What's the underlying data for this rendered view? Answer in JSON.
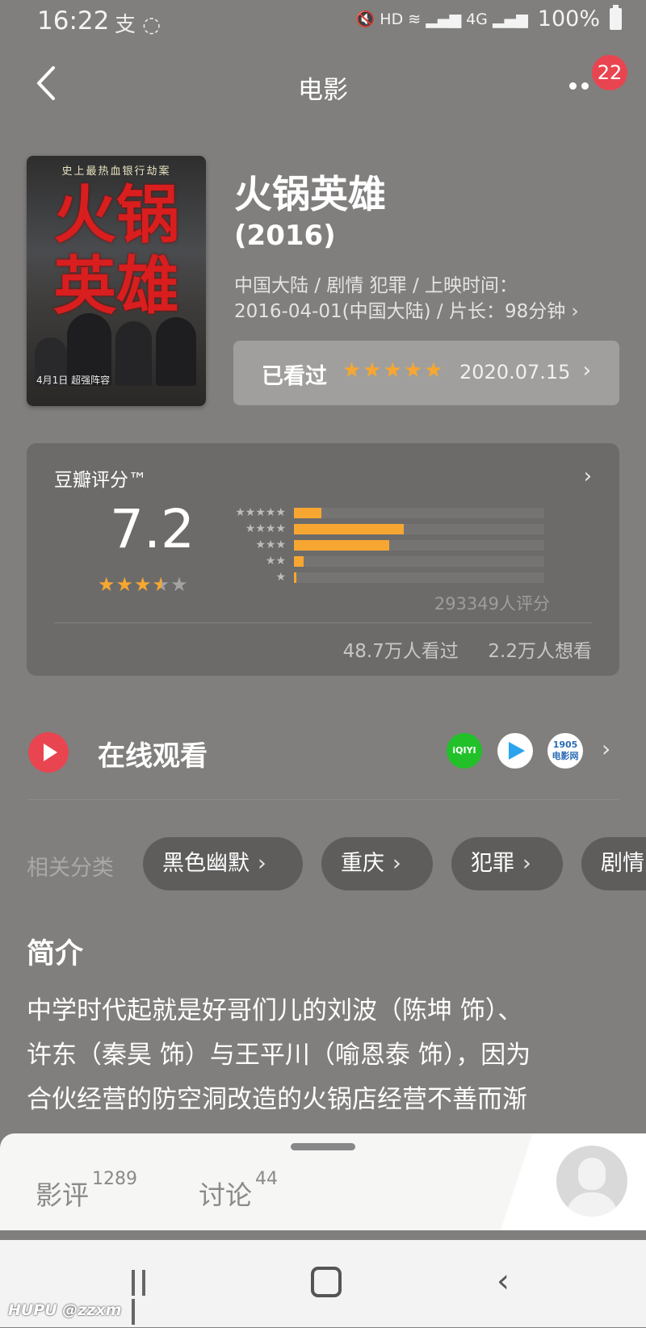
{
  "status_bar": {
    "time": "16:22",
    "app_icons": "支 ◌",
    "net_icons": "🔇 HD ≋ ▂▄▆ 4G ▂▄▆",
    "battery": "100%"
  },
  "nav": {
    "title": "电影",
    "badge": "22"
  },
  "poster": {
    "tagline": "史上最热血银行劫案",
    "title_line1": "火锅",
    "title_line2": "英雄",
    "date": "4月1日 超强阵容"
  },
  "movie": {
    "title": "火锅英雄",
    "year": "(2016)",
    "meta_line1": "中国大陆 / 剧情 犯罪 / 上映时间：",
    "meta_line2": "2016-04-01(中国大陆) / 片长：98分钟 ›"
  },
  "watched": {
    "label": "已看过",
    "stars": "★★★★★",
    "date": "2020.07.15",
    "chevron": "›"
  },
  "rating": {
    "title": "豆瓣评分™",
    "score": "7.2",
    "stars_on": "★★★",
    "star_half": "★",
    "stars_off": "★",
    "distribution": [
      {
        "stars": "★★★★★",
        "fraction": 0.11
      },
      {
        "stars": "★★★★",
        "fraction": 0.44
      },
      {
        "stars": "★★★",
        "fraction": 0.38
      },
      {
        "stars": "★★",
        "fraction": 0.04
      },
      {
        "stars": "★",
        "fraction": 0.01
      }
    ],
    "count": "293349人评分",
    "watched_count": "48.7万人看过",
    "want_count": "2.2万人想看",
    "colors": {
      "accent": "#f7a731",
      "track": "#757473"
    }
  },
  "online": {
    "label": "在线观看",
    "providers": [
      "iQIYI",
      "",
      "1905 电影网"
    ],
    "chevron": "›"
  },
  "categories": {
    "label": "相关分类",
    "items": [
      "黑色幽默",
      "重庆",
      "犯罪",
      "剧情"
    ]
  },
  "intro": {
    "title": "简介",
    "line1": "中学时代起就是好哥们儿的刘波（陈坤 饰）、",
    "line2": "许东（秦昊 饰）与王平川（喻恩泰 饰），因为",
    "line3": "合伙经营的防空洞改造的火锅店经营不善而渐"
  },
  "sheet": {
    "tab1_label": "影评",
    "tab1_count": "1289",
    "tab2_label": "讨论",
    "tab2_count": "44"
  },
  "watermark": "HUPU @zzxm"
}
